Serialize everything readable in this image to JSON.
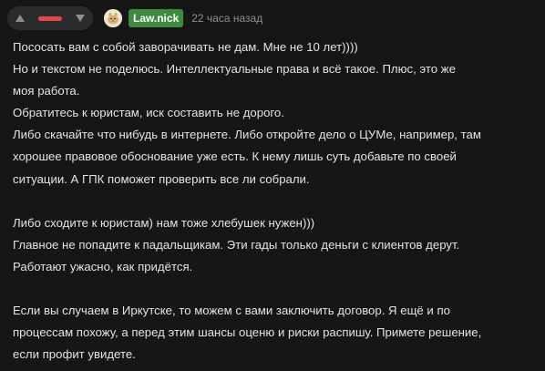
{
  "colors": {
    "background": "#161617",
    "rating_bar": "#e24a4a",
    "username_bg": "#3f8a3f",
    "text": "#e3e3e3",
    "muted": "#8f8f93"
  },
  "rating": {
    "upvote_icon": "chevron-up-icon",
    "downvote_icon": "chevron-down-icon"
  },
  "author": {
    "username": "Law.nick",
    "avatar_icon": "cat-avatar-icon",
    "time": "22 часа назад"
  },
  "comment": {
    "lines": [
      "Пососать вам с собой заворачивать не дам. Мне не 10 лет))))",
      "Но и текстом не поделюсь. Интеллектуальные права и всё такое. Плюс, это же",
      "моя работа.",
      "Обратитесь к юристам, иск составить не дорого.",
      "Либо скачайте что нибудь в интернете. Либо откройте дело о ЦУМе, например, там",
      "хорошее правовое обоснование уже есть. К нему лишь суть добавьте по своей",
      "ситуации. А ГПК поможет проверить все ли собрали.",
      "",
      "Либо сходите к юристам) нам тоже хлебушек нужен)))",
      "Главное не попадите к падальщикам. Эти гады только деньги с клиентов дерут.",
      "Работают ужасно, как придётся.",
      "",
      "Если вы случаем в Иркутске, то можем с вами заключить договор. Я ещё и по",
      "процессам похожу, а перед этим шансы оценю и риски распишу. Примете решение,",
      "если профит увидете."
    ]
  }
}
